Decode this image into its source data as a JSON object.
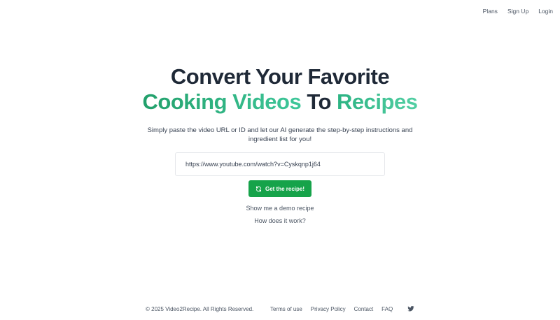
{
  "nav": {
    "items": [
      {
        "label": "Plans"
      },
      {
        "label": "Sign Up"
      },
      {
        "label": "Login"
      }
    ]
  },
  "hero": {
    "line1": "Convert Your Favorite",
    "line2_part1": "Cooking Videos",
    "line2_part2": "To",
    "line2_part3": "Recipes",
    "subtitle": "Simply paste the video URL or ID and let our AI generate the step-by-step instructions and ingredient list for you!"
  },
  "form": {
    "url_value": "https://www.youtube.com/watch?v=Cyskqnp1j64",
    "submit_label": "Get the recipe!",
    "submit_icon": "refresh-icon"
  },
  "links": {
    "demo": "Show me a demo recipe",
    "how": "How does it work?"
  },
  "footer": {
    "copyright": "© 2025 Video2Recipe. All Rights Reserved.",
    "links": [
      {
        "label": "Terms of use"
      },
      {
        "label": "Privacy Policy"
      },
      {
        "label": "Contact"
      },
      {
        "label": "FAQ"
      }
    ],
    "social_icon": "twitter-icon"
  },
  "colors": {
    "accent": "#16a34a",
    "headline_dark": "#1f2937",
    "headline_green": "#22a06b"
  }
}
